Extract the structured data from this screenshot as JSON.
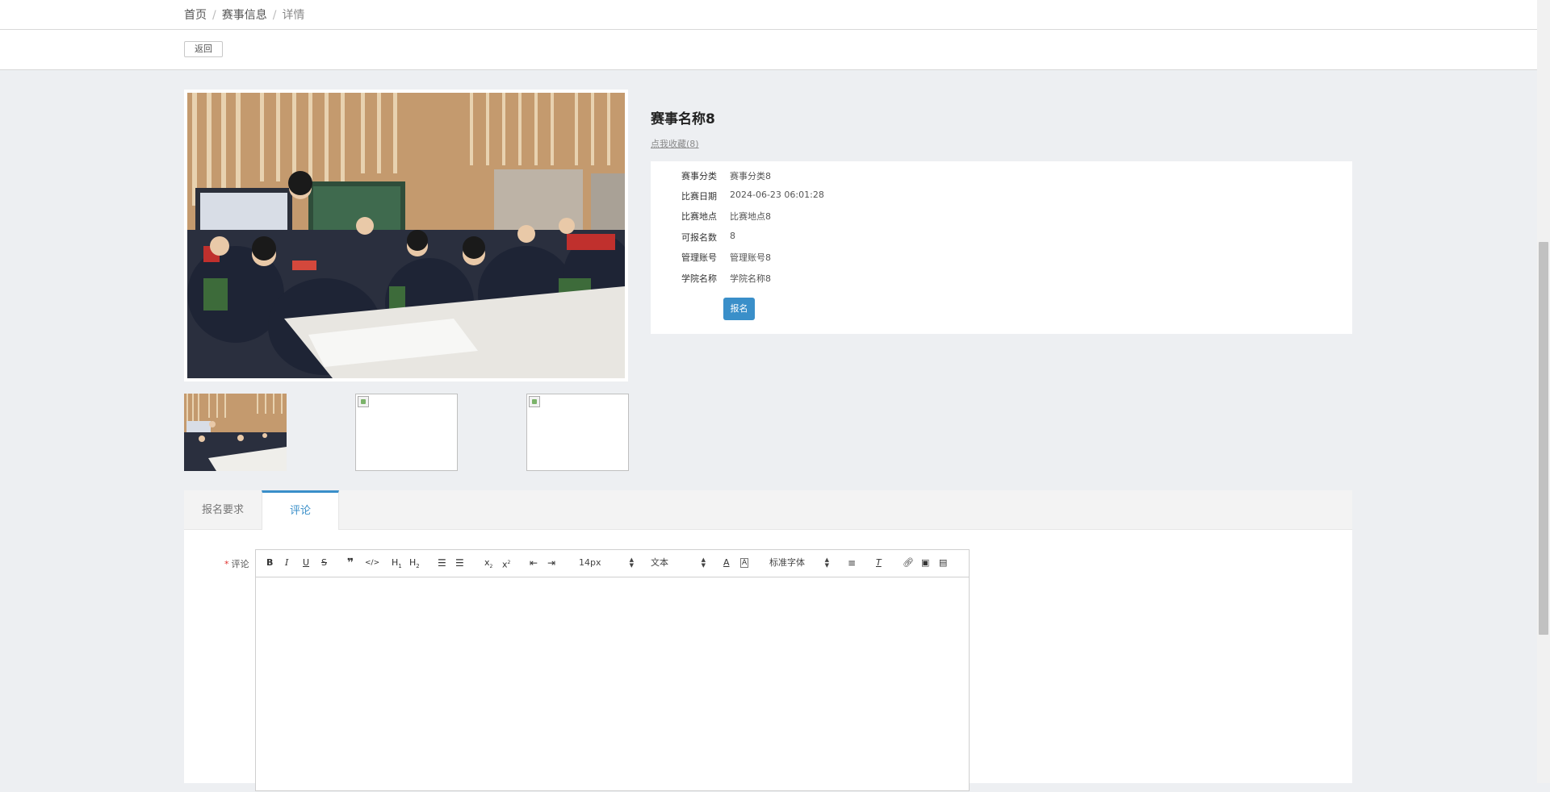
{
  "breadcrumb": {
    "home": "首页",
    "section": "赛事信息",
    "current": "详情"
  },
  "back_label": "返回",
  "event": {
    "title": "赛事名称8",
    "favorite_link": "点我收藏(8)",
    "fields": [
      {
        "label": "赛事分类",
        "value": "赛事分类8"
      },
      {
        "label": "比赛日期",
        "value": "2024-06-23 06:01:28"
      },
      {
        "label": "比赛地点",
        "value": "比赛地点8"
      },
      {
        "label": "可报名数",
        "value": "8"
      },
      {
        "label": "管理账号",
        "value": "管理账号8"
      },
      {
        "label": "学院名称",
        "value": "学院名称8"
      }
    ],
    "signup_label": "报名"
  },
  "tabs": [
    {
      "label": "报名要求"
    },
    {
      "label": "评论"
    }
  ],
  "comment_form": {
    "required_mark": "*",
    "label": "评论",
    "font_size": "14px",
    "text_style": "文本",
    "font_family_label": "标准字体"
  }
}
